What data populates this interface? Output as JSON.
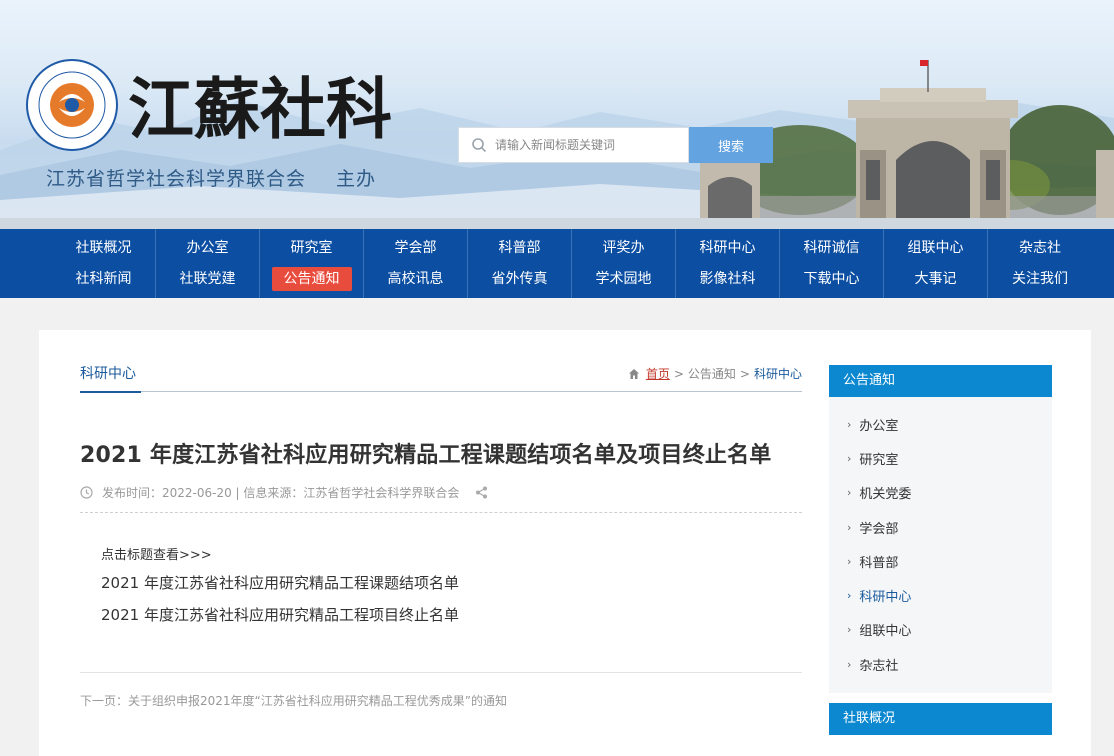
{
  "header": {
    "logo_text": "江蘇社科",
    "org_name": "江苏省哲学社会科学界联合会",
    "host": "主办",
    "search_placeholder": "请输入新闻标题关键词",
    "search_button": "搜索"
  },
  "nav": [
    [
      "社联概况",
      "社科新闻"
    ],
    [
      "办公室",
      "社联党建"
    ],
    [
      "研究室",
      "公告通知"
    ],
    [
      "学会部",
      "高校讯息"
    ],
    [
      "科普部",
      "省外传真"
    ],
    [
      "评奖办",
      "学术园地"
    ],
    [
      "科研中心",
      "影像社科"
    ],
    [
      "科研诚信",
      "下载中心"
    ],
    [
      "组联中心",
      "大事记"
    ],
    [
      "杂志社",
      "关注我们"
    ]
  ],
  "nav_active": "公告通知",
  "page": {
    "section_title": "科研中心",
    "breadcrumb": {
      "home": "首页",
      "sep": ">",
      "level1": "公告通知",
      "level2": "科研中心"
    },
    "article_title": "2021 年度江苏省社科应用研究精品工程课题结项名单及项目终止名单",
    "meta": "发布时间：2022-06-20 | 信息来源：江苏省哲学社会科学界联合会",
    "hint": "点击标题查看>>>",
    "links": [
      "2021 年度江苏省社科应用研究精品工程课题结项名单",
      "2021 年度江苏省社科应用研究精品工程项目终止名单"
    ],
    "next_page": "下一页：关于组织申报2021年度“江苏省社科应用研究精品工程优秀成果”的通知"
  },
  "sidebar": {
    "heading": "公告通知",
    "items": [
      "办公室",
      "研究室",
      "机关党委",
      "学会部",
      "科普部",
      "科研中心",
      "组联中心",
      "杂志社"
    ],
    "active": "科研中心",
    "heading2": "社联概况"
  },
  "colors": {
    "nav_bg": "#0b4ea2",
    "active_red": "#e84c3d",
    "sidebar_head": "#0b88d0",
    "link_blue": "#1c5a9c"
  }
}
